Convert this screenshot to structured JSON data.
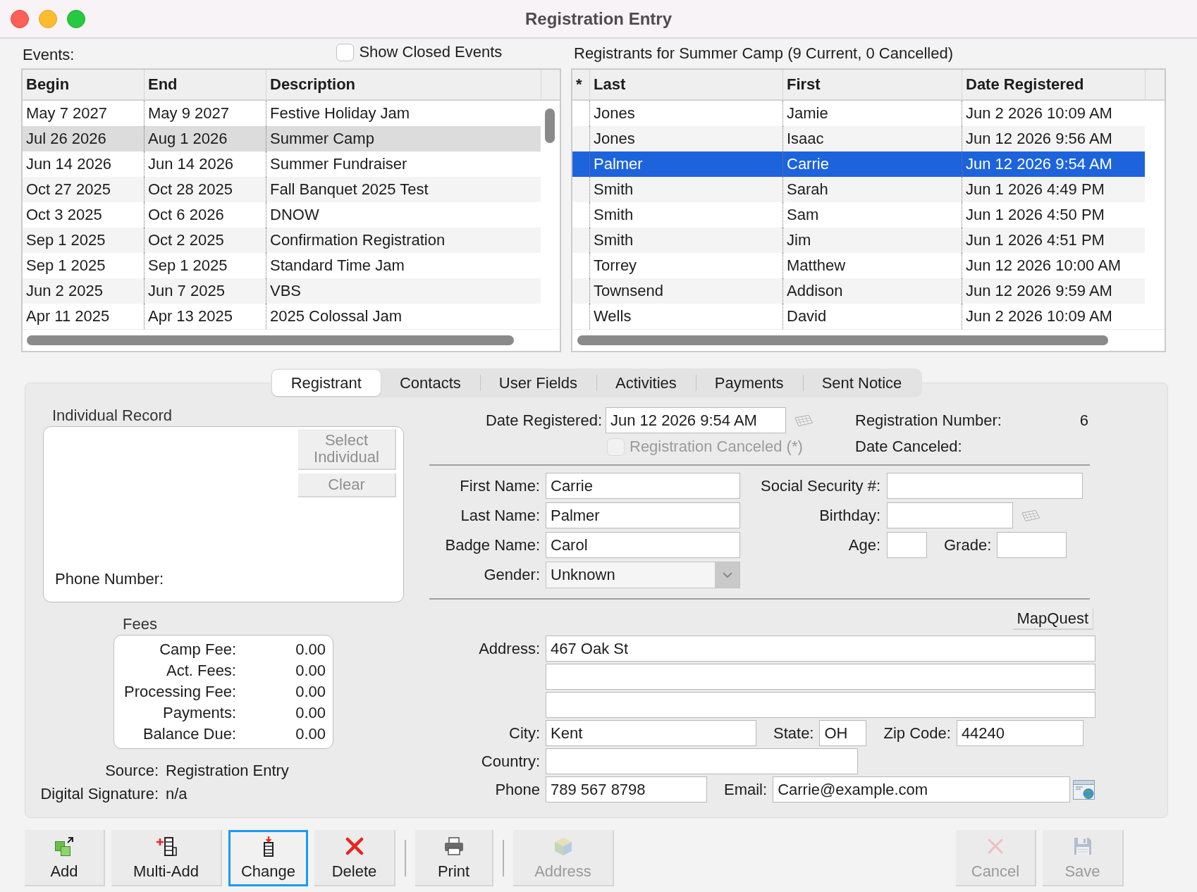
{
  "window": {
    "title": "Registration Entry"
  },
  "events": {
    "label": "Events:",
    "show_closed": {
      "label": "Show Closed Events",
      "checked": false
    },
    "focused": false,
    "columns": [
      "Begin",
      "End",
      "Description"
    ],
    "rows": [
      {
        "cells": [
          "May 7 2027",
          "May 9 2027",
          "Festive Holiday Jam"
        ],
        "selected": false
      },
      {
        "cells": [
          "Jul 26 2026",
          "Aug 1 2026",
          "Summer Camp"
        ],
        "selected": true
      },
      {
        "cells": [
          "Jun 14 2026",
          "Jun 14 2026",
          "Summer Fundraiser"
        ],
        "selected": false
      },
      {
        "cells": [
          "Oct 27 2025",
          "Oct 28 2025",
          "Fall Banquet 2025 Test"
        ],
        "selected": false
      },
      {
        "cells": [
          "Oct 3 2025",
          "Oct 6 2026",
          "DNOW"
        ],
        "selected": false
      },
      {
        "cells": [
          "Sep 1 2025",
          "Oct 2 2025",
          "Confirmation Registration"
        ],
        "selected": false
      },
      {
        "cells": [
          "Sep 1 2025",
          "Sep 1 2025",
          "Standard Time Jam"
        ],
        "selected": false
      },
      {
        "cells": [
          "Jun 2 2025",
          "Jun 7 2025",
          "VBS"
        ],
        "selected": false
      },
      {
        "cells": [
          "Apr 11 2025",
          "Apr 13 2025",
          "2025 Colossal Jam"
        ],
        "selected": false
      }
    ]
  },
  "registrants": {
    "label": "Registrants for Summer Camp (9 Current, 0 Cancelled)",
    "focused": true,
    "columns": [
      "*",
      "Last",
      "First",
      "Date Registered"
    ],
    "rows": [
      {
        "cells": [
          "",
          "Jones",
          "Jamie",
          "Jun 2 2026 10:09 AM"
        ],
        "selected": false
      },
      {
        "cells": [
          "",
          "Jones",
          "Isaac",
          "Jun 12 2026 9:56 AM"
        ],
        "selected": false
      },
      {
        "cells": [
          "",
          "Palmer",
          "Carrie",
          "Jun 12 2026 9:54 AM"
        ],
        "selected": true
      },
      {
        "cells": [
          "",
          "Smith",
          "Sarah",
          "Jun 1 2026 4:49 PM"
        ],
        "selected": false
      },
      {
        "cells": [
          "",
          "Smith",
          "Sam",
          "Jun 1 2026 4:50 PM"
        ],
        "selected": false
      },
      {
        "cells": [
          "",
          "Smith",
          "Jim",
          "Jun 1 2026 4:51 PM"
        ],
        "selected": false
      },
      {
        "cells": [
          "",
          "Torrey",
          "Matthew",
          "Jun 12 2026 10:00 AM"
        ],
        "selected": false
      },
      {
        "cells": [
          "",
          "Townsend",
          "Addison",
          "Jun 12 2026 9:59 AM"
        ],
        "selected": false
      },
      {
        "cells": [
          "",
          "Wells",
          "David",
          "Jun 2 2026 10:09 AM"
        ],
        "selected": false
      }
    ]
  },
  "tabs": [
    {
      "label": "Registrant",
      "selected": true
    },
    {
      "label": "Contacts",
      "selected": false
    },
    {
      "label": "User Fields",
      "selected": false
    },
    {
      "label": "Activities",
      "selected": false
    },
    {
      "label": "Payments",
      "selected": false
    },
    {
      "label": "Sent Notice",
      "selected": false
    }
  ],
  "individual_record": {
    "title": "Individual Record",
    "buttons": [
      {
        "label": "Select Individual",
        "disabled": true
      },
      {
        "label": "Clear",
        "disabled": true
      }
    ],
    "phone_label": "Phone Number:"
  },
  "fees": {
    "title": "Fees",
    "rows": [
      {
        "label": "Camp Fee:",
        "value": "0.00"
      },
      {
        "label": "Act. Fees:",
        "value": "0.00"
      },
      {
        "label": "Processing Fee:",
        "value": "0.00"
      },
      {
        "label": "Payments:",
        "value": "0.00"
      },
      {
        "label": "Balance Due:",
        "value": "0.00"
      }
    ]
  },
  "source": {
    "label": "Source:",
    "value": "Registration Entry"
  },
  "digital_signature": {
    "label": "Digital Signature:",
    "value": "n/a"
  },
  "registration": {
    "date_registered": {
      "kind": "date",
      "label": "Date Registered:",
      "value": "Jun 12 2026 9:54 AM"
    },
    "registration_number": {
      "label": "Registration Number:",
      "value": "6"
    },
    "canceled": {
      "label": "Registration Canceled (*)",
      "checked": false,
      "disabled": true
    },
    "date_canceled": {
      "label": "Date Canceled:"
    }
  },
  "personal": {
    "left": [
      {
        "kind": "text",
        "label": "First Name:",
        "value": "Carrie"
      },
      {
        "kind": "text",
        "label": "Last Name:",
        "value": "Palmer"
      },
      {
        "kind": "text",
        "label": "Badge Name:",
        "value": "Carol"
      },
      {
        "kind": "select",
        "label": "Gender:",
        "value": "Unknown"
      }
    ],
    "right": [
      {
        "fields": [
          {
            "kind": "text",
            "label": "Social Security #:"
          }
        ]
      },
      {
        "fields": [
          {
            "kind": "date",
            "label": "Birthday:"
          }
        ]
      },
      {
        "fields": [
          {
            "kind": "text",
            "label": "Age:"
          },
          {
            "kind": "text",
            "label": "Grade:"
          }
        ]
      }
    ]
  },
  "address": {
    "map_button": "MapQuest",
    "rows": [
      {
        "fields": [
          {
            "kind": "text",
            "label": "Address:",
            "value": "467 Oak St"
          }
        ]
      },
      {
        "fields": [
          {
            "kind": "text"
          }
        ]
      },
      {
        "fields": [
          {
            "kind": "text"
          }
        ]
      },
      {
        "fields": [
          {
            "kind": "text",
            "label": "City:",
            "value": "Kent"
          },
          {
            "kind": "text",
            "label": "State:",
            "value": "OH"
          },
          {
            "kind": "text",
            "label": "Zip Code:",
            "value": "44240"
          }
        ]
      },
      {
        "fields": [
          {
            "kind": "text",
            "label": "Country:"
          }
        ]
      },
      {
        "fields": [
          {
            "kind": "text",
            "label": "Phone",
            "value": "789 567 8798"
          },
          {
            "kind": "email",
            "label": "Email:",
            "value": "Carrie@example.com"
          }
        ]
      }
    ]
  },
  "toolbar": {
    "groups": [
      {
        "buttons": [
          {
            "kind": "add",
            "label": "Add",
            "disabled": false,
            "focused": false
          },
          {
            "kind": "multiadd",
            "label": "Multi-Add",
            "disabled": false,
            "focused": false
          },
          {
            "kind": "change",
            "label": "Change",
            "disabled": false,
            "focused": true
          },
          {
            "kind": "delete",
            "label": "Delete",
            "disabled": false,
            "focused": false
          }
        ]
      },
      {
        "buttons": [
          {
            "kind": "print",
            "label": "Print",
            "disabled": false,
            "focused": false
          }
        ]
      },
      {
        "buttons": [
          {
            "kind": "address",
            "label": "Address",
            "disabled": true,
            "focused": false
          }
        ]
      }
    ],
    "end_buttons": [
      {
        "kind": "cancel",
        "label": "Cancel",
        "disabled": true,
        "focused": false
      },
      {
        "kind": "save",
        "label": "Save",
        "disabled": true,
        "focused": false
      }
    ]
  }
}
